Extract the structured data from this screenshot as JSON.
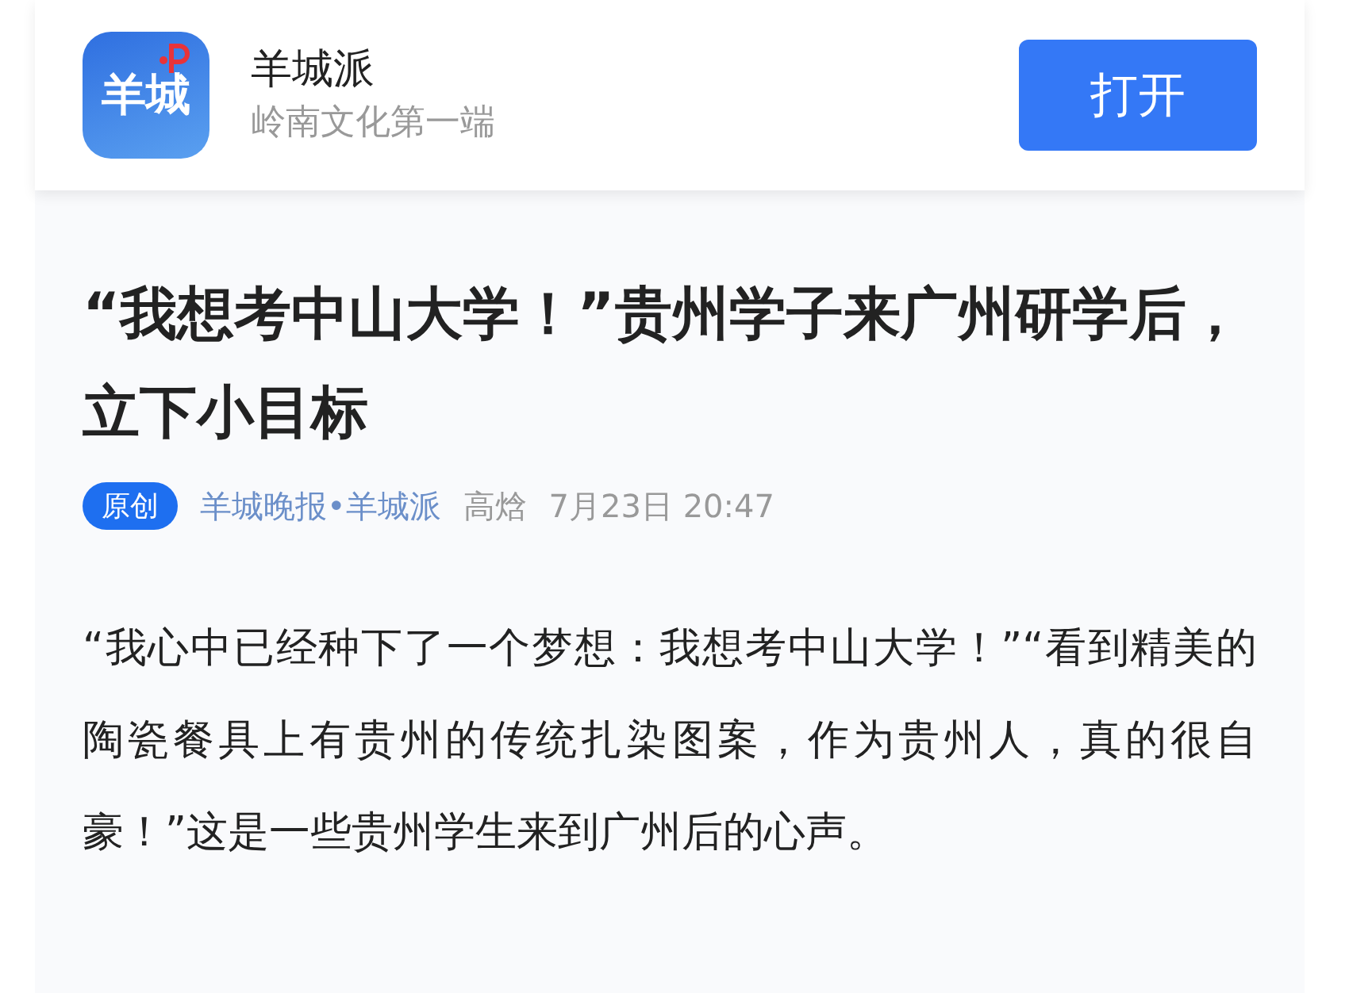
{
  "app_banner": {
    "logo_text": "羊城",
    "name": "羊城派",
    "slogan": "岭南文化第一端",
    "open_button": "打开"
  },
  "article": {
    "title": "“我想考中山大学！”贵州学子来广州研学后，立下小目标",
    "meta": {
      "badge": "原创",
      "source": "羊城晚报•羊城派",
      "author": "高焓",
      "time": "7月23日 20:47"
    },
    "paragraphs": [
      "“我心中已经种下了一个梦想：我想考中山大学！”“看到精美的陶瓷餐具上有贵州的传统扎染图案，作为贵州人，真的很自豪！”这是一些贵州学生来到广州后的心声。"
    ]
  }
}
